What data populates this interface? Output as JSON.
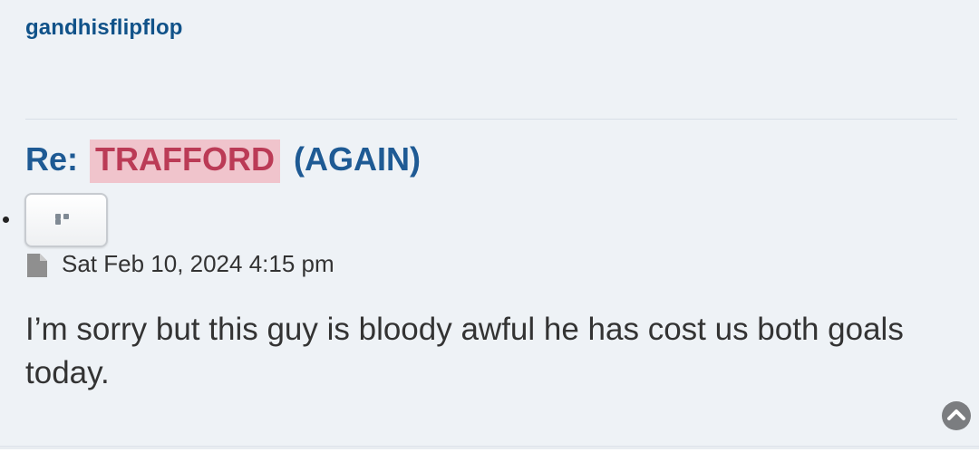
{
  "post": {
    "author": "gandhisflipflop",
    "title_prefix": "Re:",
    "title_highlight": "TRAFFORD",
    "title_suffix": "(AGAIN)",
    "timestamp": "Sat Feb 10, 2024 4:15 pm",
    "content": "I’m sorry but this guy is bloody awful he has cost us both goals today."
  },
  "icons": {
    "more": "ellipsis-icon",
    "post": "file-icon",
    "top": "chevron-up-circle-icon"
  },
  "colors": {
    "author": "#105289",
    "title": "#1e5a94",
    "highlight_bg": "#f0c4cc",
    "highlight_text": "#bb3b56",
    "post_bg": "#eef2f6"
  }
}
